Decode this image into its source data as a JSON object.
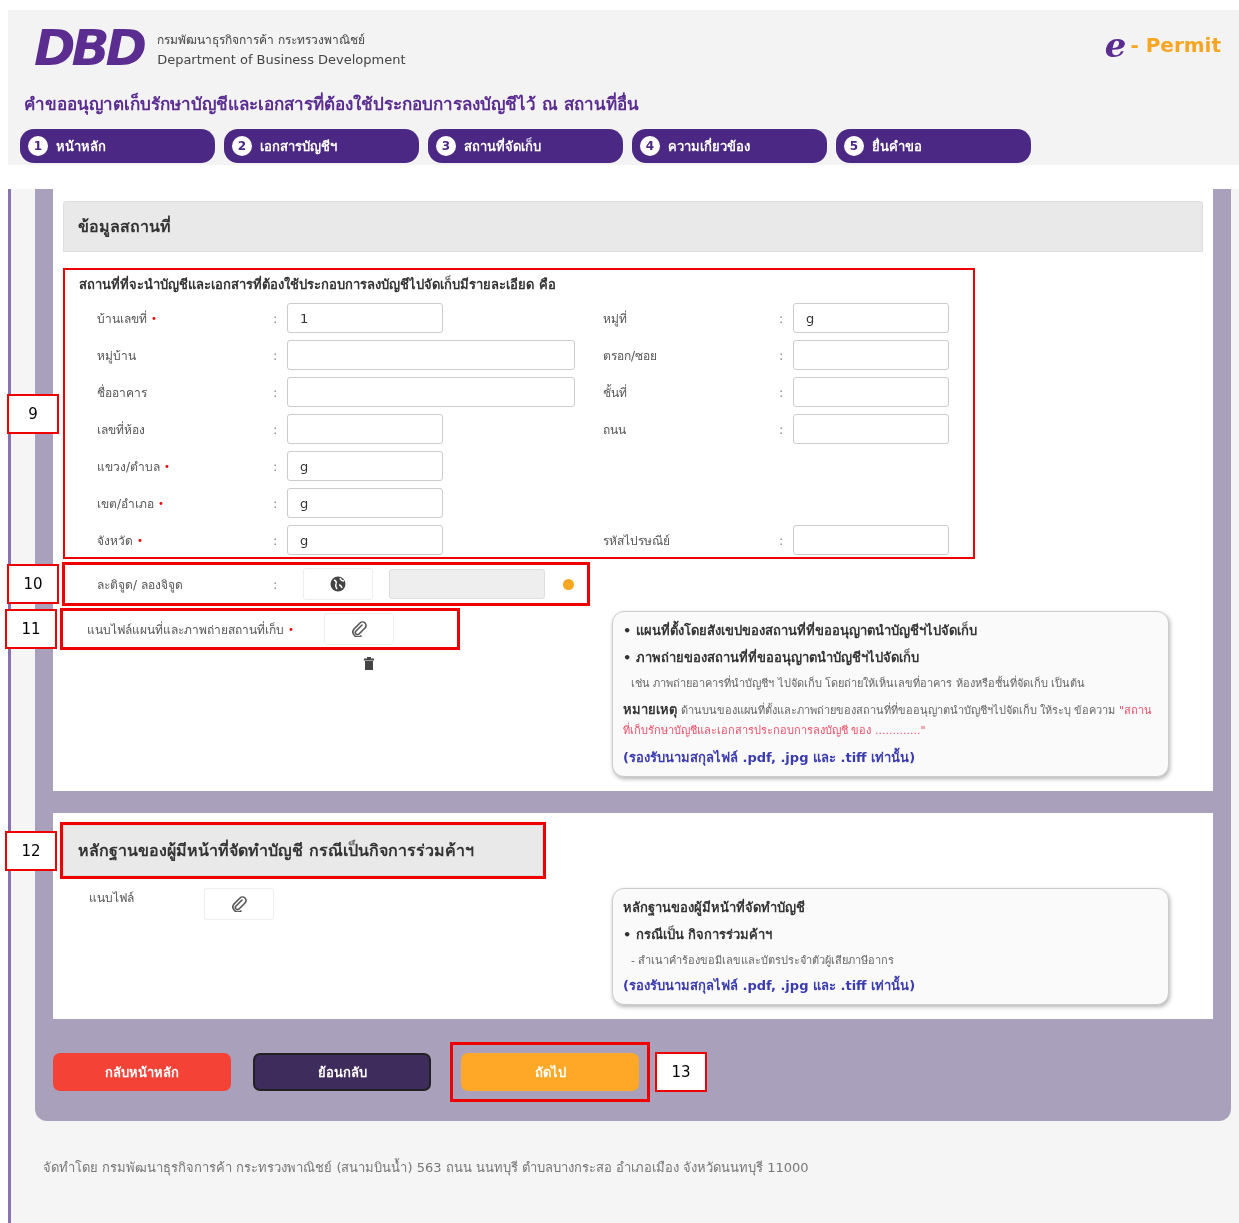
{
  "header": {
    "logo_text": "DBD",
    "org_thai": "กรมพัฒนาธุรกิจการค้า กระทรวงพาณิชย์",
    "org_english": "Department of Business Development",
    "brand_letter": "e",
    "brand_text": "- Permit",
    "title": "คำขออนุญาตเก็บรักษาบัญชีและเอกสารที่ต้องใช้ประกอบการลงบัญชีไว้ ณ สถานที่อื่น"
  },
  "steps": [
    {
      "number": "1",
      "label": "หน้าหลัก"
    },
    {
      "number": "2",
      "label": "เอกสารบัญชีฯ"
    },
    {
      "number": "3",
      "label": "สถานที่จัดเก็บ"
    },
    {
      "number": "4",
      "label": "ความเกี่ยวข้อง"
    },
    {
      "number": "5",
      "label": "ยื่นคำขอ"
    }
  ],
  "location_section": {
    "title": "ข้อมูลสถานที่",
    "address": {
      "callout": "9",
      "heading": "สถานที่ที่จะนำบัญชีและเอกสารที่ต้องใช้ประกอบการลงบัญชีไปจัดเก็บมีรายละเอียด คือ",
      "rows": [
        {
          "left": {
            "label": "บ้านเลขที่",
            "required_mark": "•",
            "colon": ":",
            "value": "1",
            "kind": "short"
          },
          "right": {
            "label": "หมู่ที่",
            "colon": ":",
            "value": "g",
            "kind": "short"
          }
        },
        {
          "left": {
            "label": "หมู่บ้าน",
            "colon": ":",
            "kind": "wide"
          },
          "right": {
            "label": "ตรอก/ซอย",
            "colon": ":",
            "kind": "short"
          }
        },
        {
          "left": {
            "label": "ชื่ออาคาร",
            "colon": ":",
            "kind": "wide"
          },
          "right": {
            "label": "ชั้นที่",
            "colon": ":",
            "kind": "short"
          }
        },
        {
          "left": {
            "label": "เลขที่ห้อง",
            "colon": ":",
            "kind": "short"
          },
          "right": {
            "label": "ถนน",
            "colon": ":",
            "kind": "short"
          }
        },
        {
          "left": {
            "label": "แขวง/ตำบล",
            "required_mark": "•",
            "colon": ":",
            "value": "g",
            "kind": "short"
          }
        },
        {
          "left": {
            "label": "เขต/อำเภอ",
            "required_mark": "•",
            "colon": ":",
            "value": "g",
            "kind": "short"
          }
        },
        {
          "left": {
            "label": "จังหวัด",
            "required_mark": "•",
            "colon": ":",
            "value": "g",
            "kind": "short"
          },
          "right": {
            "label": "รหัสไปรษณีย์",
            "colon": ":",
            "kind": "short"
          }
        }
      ]
    },
    "coordinates": {
      "callout": "10",
      "label": "ละติจูด/ ลองจิจูด",
      "colon": ":",
      "disabled": true
    },
    "attachment": {
      "callout": "11",
      "label": "แนบไฟล์แผนที่และภาพถ่ายสถานที่เก็บ",
      "required_mark": "•"
    },
    "info": [
      {
        "kind": "bullet",
        "marker": "•",
        "text": "แผนที่ตั้งโดยสังเขปของสถานที่ที่ขออนุญาตนำบัญชีฯไปจัดเก็บ"
      },
      {
        "kind": "bullet",
        "marker": "•",
        "text": "ภาพถ่ายของสถานที่ที่ขออนุญาตนำบัญชีฯไปจัดเก็บ"
      },
      {
        "kind": "note",
        "text": "เช่น ภาพถ่ายอาคารที่นำบัญชีฯ ไปจัดเก็บ โดยถ่ายให้เห็นเลขที่อาคาร ห้องหรือชั้นที่จัดเก็บ เป็นต้น"
      },
      {
        "kind": "remark",
        "label": "หมายเหตุ",
        "text": "ด้านบนของแผนที่ตั้งและภาพถ่ายของสถานที่ที่ขออนุญาตนำบัญชีฯไปจัดเก็บ ให้ระบุ ข้อความ",
        "quote": "\"สถานที่เก็บรักษาบัญชีและเอกสารประกอบการลงบัญชี ของ .............\""
      },
      {
        "kind": "formats",
        "text": "(รองรับนามสกุลไฟล์ .pdf, .jpg และ .tiff เท่านั้น)"
      }
    ]
  },
  "evidence_section": {
    "title": "หลักฐานของผู้มีหน้าที่จัดทำบัญชี กรณีเป็นกิจการร่วมค้าฯ",
    "callout": "12",
    "attach_label": "แนบไฟล์",
    "info": [
      {
        "kind": "heading",
        "text": "หลักฐานของผู้มีหน้าที่จัดทำบัญชี"
      },
      {
        "kind": "bullet",
        "marker": "•",
        "text": "กรณีเป็น กิจการร่วมค้าฯ"
      },
      {
        "kind": "note",
        "text": "- สำเนาคำร้องขอมีเลขและบัตรประจำตัวผู้เสียภาษีอากร"
      },
      {
        "kind": "formats",
        "text": "(รองรับนามสกุลไฟล์ .pdf, .jpg และ .tiff เท่านั้น)"
      }
    ]
  },
  "buttons": [
    {
      "kind": "home",
      "label": "กลับหน้าหลัก"
    },
    {
      "kind": "back",
      "label": "ย้อนกลับ"
    },
    {
      "kind": "next",
      "label": "ถัดไป",
      "callout": "13"
    }
  ],
  "footer": "จัดทำโดย กรมพัฒนาธุรกิจการค้า กระทรวงพาณิชย์ (สนามบินน้ำ) 563 ถนน นนทบุรี ตำบลบางกระสอ อำเภอเมือง จังหวัดนนทบุรี 11000"
}
